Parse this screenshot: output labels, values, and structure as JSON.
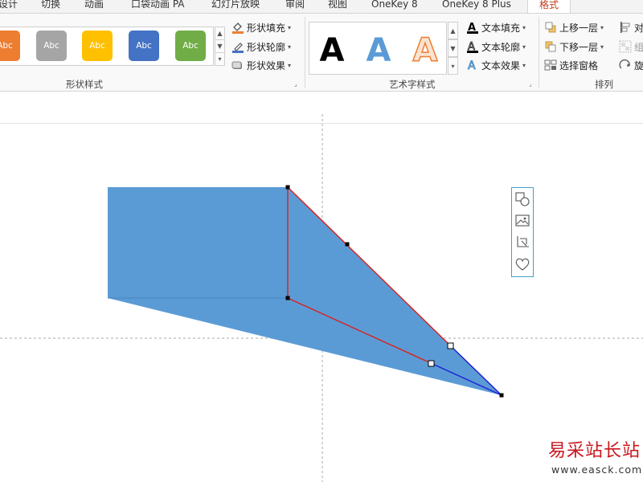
{
  "tabs": [
    {
      "label": "设计"
    },
    {
      "label": "切换"
    },
    {
      "label": "动画"
    },
    {
      "label": "口袋动画 PA"
    },
    {
      "label": "幻灯片放映"
    },
    {
      "label": "审阅"
    },
    {
      "label": "视图"
    },
    {
      "label": "OneKey 8"
    },
    {
      "label": "OneKey 8 Plus"
    },
    {
      "label": "格式",
      "active": true
    }
  ],
  "shape_styles": {
    "group_label": "形状样式",
    "swatches": [
      {
        "label": "Abc",
        "color": "#ed7d31"
      },
      {
        "label": "Abc",
        "color": "#a5a5a5"
      },
      {
        "label": "Abc",
        "color": "#ffc000"
      },
      {
        "label": "Abc",
        "color": "#4472c4"
      },
      {
        "label": "Abc",
        "color": "#70ad47"
      }
    ],
    "commands": {
      "fill": "形状填充",
      "outline": "形状轮廓",
      "effects": "形状效果"
    }
  },
  "wordart_styles": {
    "group_label": "艺术字样式",
    "samples": [
      {
        "label": "A",
        "color": "#000000"
      },
      {
        "label": "A",
        "color": "#5b9bd5"
      },
      {
        "label": "A",
        "color": "#f4b183"
      }
    ],
    "commands": {
      "fill": "文本填充",
      "outline": "文本轮廓",
      "effects": "文本效果"
    }
  },
  "arrange": {
    "group_label": "排列",
    "commands": {
      "bring_forward": "上移一层",
      "send_backward": "下移一层",
      "selection_pane": "选择窗格",
      "align": "对",
      "group": "组",
      "rotate": "旋"
    }
  },
  "colors": {
    "accent": "#c43b1d",
    "shape_fill": "#5b9bd5",
    "selection_line": "#d62525",
    "edge_line": "#1f1fd6",
    "floater_border": "#43a0c8"
  },
  "floating_toolbar": {
    "icons": [
      "shapes-icon",
      "picture-icon",
      "crop-icon",
      "heart-icon"
    ]
  },
  "watermark": {
    "text": "易采站长站",
    "url": "www.easck.com"
  }
}
